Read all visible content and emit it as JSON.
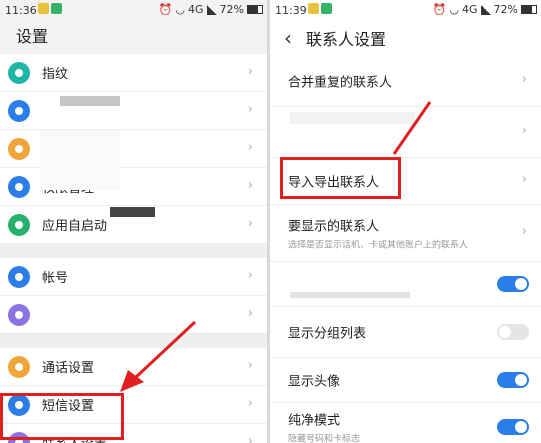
{
  "left": {
    "status": {
      "time": "11:36",
      "network": "4G",
      "battery": "72%",
      "battery_fraction": 0.72
    },
    "title": "设置",
    "items": [
      {
        "label": "指纹",
        "icon": "fingerprint-icon",
        "color": "#1fb6a8"
      },
      {
        "label": "",
        "icon": "shield-icon",
        "color": "#2b7de9"
      },
      {
        "label": "",
        "icon": "lock-icon",
        "color": "#f0a53a"
      },
      {
        "label": "权限管理",
        "icon": "android-icon",
        "color": "#2b7de9"
      },
      {
        "label": "应用自启动",
        "icon": "check-icon",
        "color": "#25b06b"
      },
      {
        "label": "帐号",
        "icon": "person-icon",
        "color": "#2b7de9"
      },
      {
        "label": "",
        "icon": "cloud-icon",
        "color": "#8a74e5"
      },
      {
        "label": "通话设置",
        "icon": "phone-icon",
        "color": "#f0a53a"
      },
      {
        "label": "短信设置",
        "icon": "message-icon",
        "color": "#2b7de9"
      },
      {
        "label": "联系人设置",
        "icon": "contact-icon",
        "color": "#8a74e5"
      }
    ],
    "chevron": "›"
  },
  "right": {
    "status": {
      "time": "11:39",
      "network": "4G",
      "battery": "72%",
      "battery_fraction": 0.72
    },
    "back": "‹",
    "title": "联系人设置",
    "items": [
      {
        "label": "合并重复的联系人"
      },
      {
        "label": ""
      },
      {
        "label": "导入导出联系人"
      },
      {
        "label": "要显示的联系人",
        "sub": "选择是否显示话机、卡或其他账户上的联系人"
      },
      {
        "label": "",
        "toggle": true
      },
      {
        "label": "显示分组列表",
        "toggle": false
      },
      {
        "label": "显示头像",
        "toggle": true
      },
      {
        "label": "纯净模式",
        "sub": "隐藏号码和卡标志",
        "toggle": true
      }
    ],
    "chevron": "›"
  },
  "colors": {
    "accent": "#2b7de9",
    "highlight": "#e02020"
  }
}
